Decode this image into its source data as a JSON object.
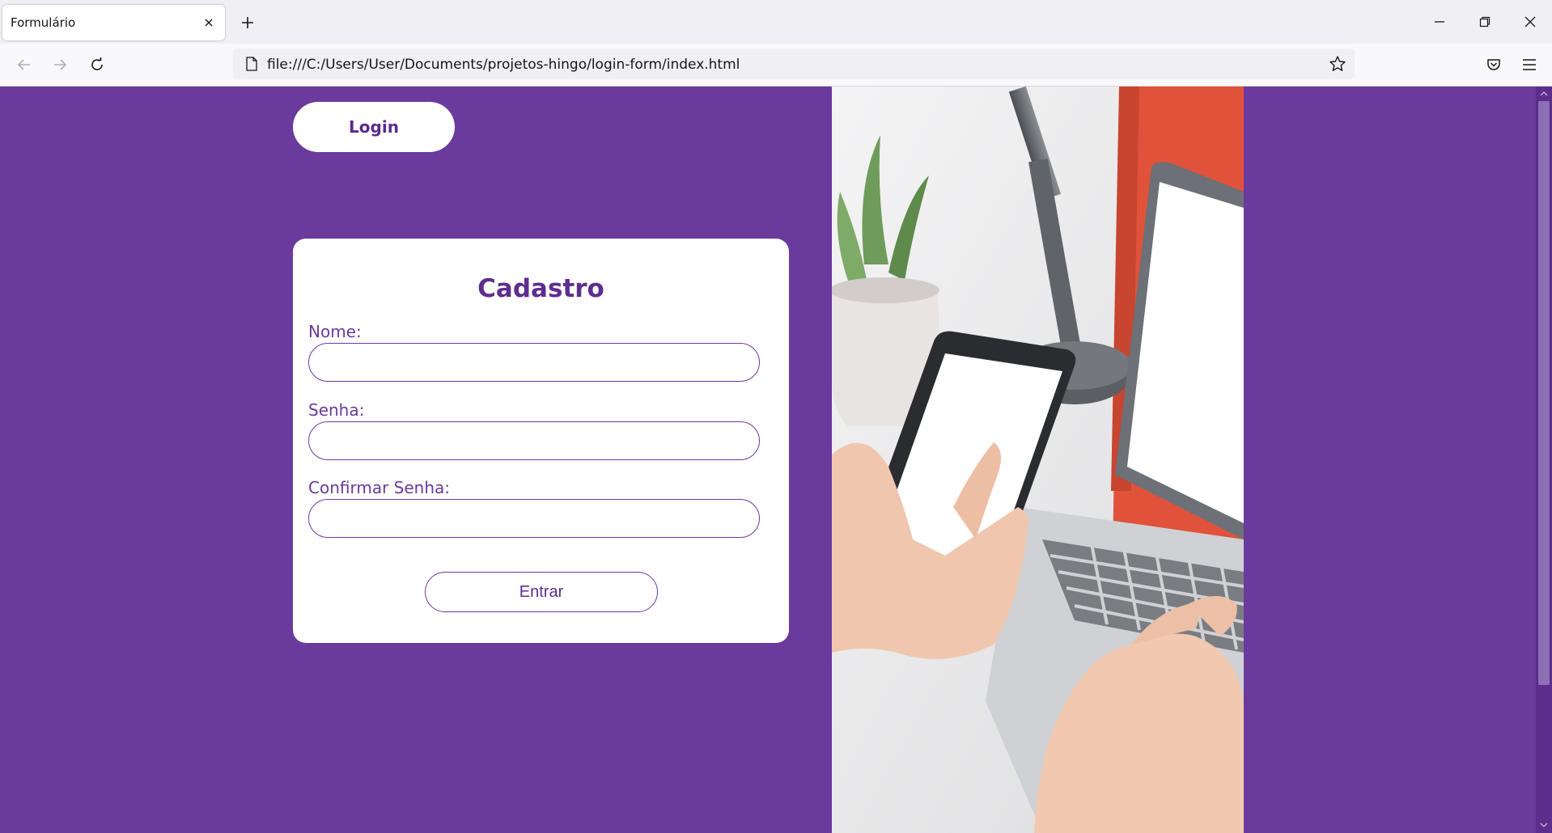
{
  "browser": {
    "tab_title": "Formulário",
    "url": "file:///C:/Users/User/Documents/projetos-hingo/login-form/index.html"
  },
  "page": {
    "login_button": "Login",
    "form": {
      "title": "Cadastro",
      "fields": [
        {
          "label": "Nome:",
          "value": ""
        },
        {
          "label": "Senha:",
          "value": ""
        },
        {
          "label": "Confirmar Senha:",
          "value": ""
        }
      ],
      "submit_label": "Entrar"
    }
  },
  "colors": {
    "brand_purple": "#6a3a9c",
    "card_bg": "#ffffff"
  }
}
